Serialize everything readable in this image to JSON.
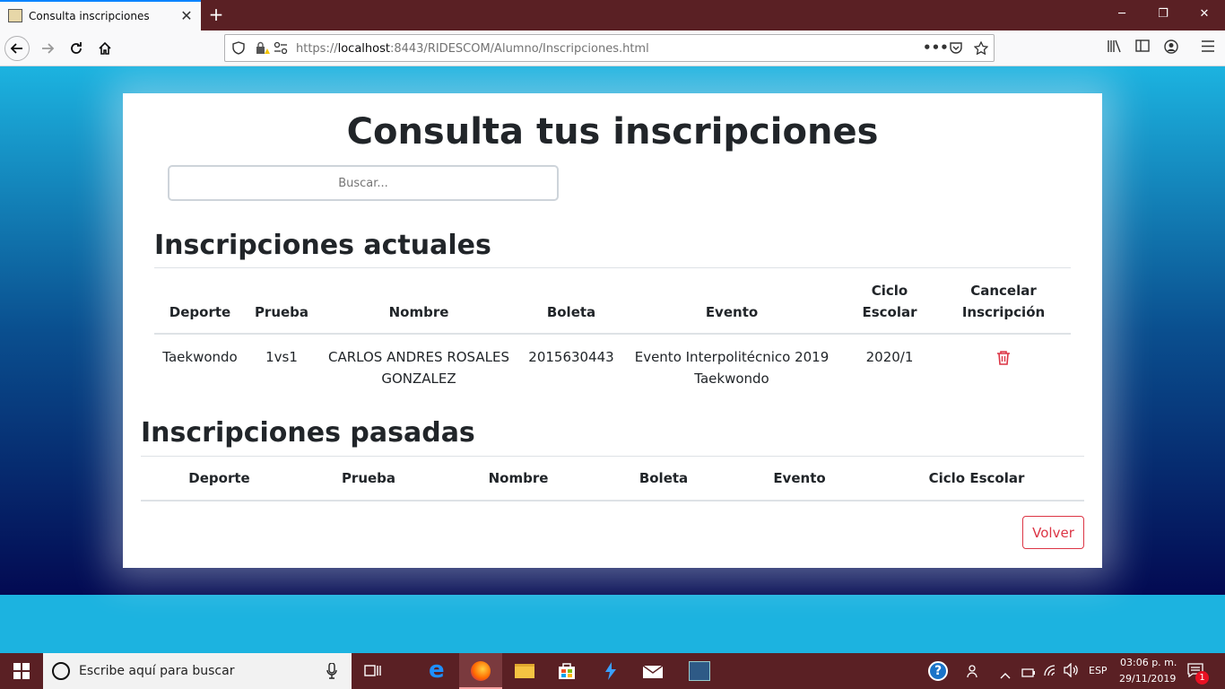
{
  "browser": {
    "tab_title": "Consulta inscripciones",
    "tab_close": "✕",
    "new_tab": "+",
    "url_prefix": "https://",
    "url_host": "localhost",
    "url_rest": ":8443/RIDESCOM/Alumno/Inscripciones.html",
    "window_controls": {
      "minimize": "─",
      "restore": "❐",
      "close": "✕"
    },
    "icons": [
      "back-icon",
      "forward-icon",
      "reload-icon",
      "home-icon",
      "shield-icon",
      "lock-warning-icon",
      "permissions-icon",
      "more-icon",
      "pocket-icon",
      "bookmark-star-icon",
      "library-icon",
      "sidebar-icon",
      "account-icon",
      "menu-icon"
    ]
  },
  "page": {
    "title": "Consulta tus inscripciones",
    "search_placeholder": "Buscar...",
    "current": {
      "title": "Inscripciones actuales",
      "headers": {
        "deporte": "Deporte",
        "prueba": "Prueba",
        "nombre": "Nombre",
        "boleta": "Boleta",
        "evento": "Evento",
        "ciclo_1": "Ciclo",
        "ciclo_2": "Escolar",
        "cancelar_1": "Cancelar",
        "cancelar_2": "Inscripción"
      },
      "rows": [
        {
          "deporte": "Taekwondo",
          "prueba": "1vs1",
          "nombre_1": "CARLOS ANDRES ROSALES",
          "nombre_2": "GONZALEZ",
          "boleta": "2015630443",
          "evento_1": "Evento Interpolitécnico 2019",
          "evento_2": "Taekwondo",
          "ciclo": "2020/1"
        }
      ]
    },
    "past": {
      "title": "Inscripciones pasadas",
      "headers": {
        "deporte": "Deporte",
        "prueba": "Prueba",
        "nombre": "Nombre",
        "boleta": "Boleta",
        "evento": "Evento",
        "ciclo": "Ciclo Escolar"
      }
    },
    "back_button": "Volver",
    "colors": {
      "danger": "#dc3545",
      "text": "#212529"
    }
  },
  "taskbar": {
    "search_placeholder": "Escribe aquí para buscar",
    "language": "ESP",
    "time": "03:06 p. m.",
    "date": "29/11/2019",
    "notification_count": "1"
  }
}
